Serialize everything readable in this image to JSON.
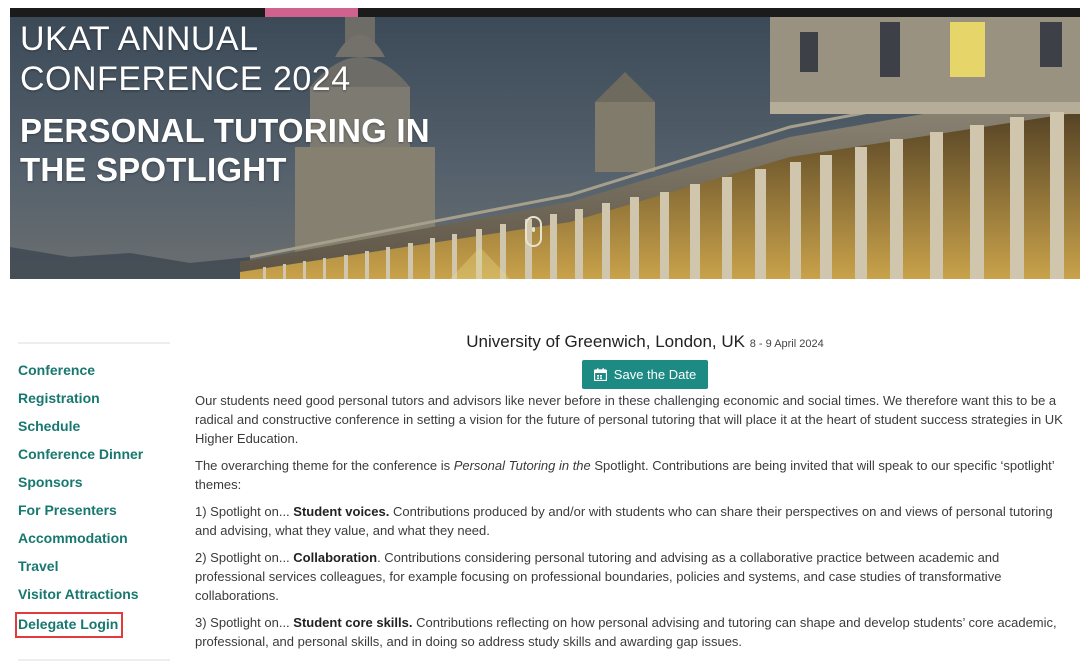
{
  "hero": {
    "title_line1": "UKAT ANNUAL",
    "title_line2": "CONFERENCE 2024",
    "subtitle_line1": "PERSONAL TUTORING IN",
    "subtitle_line2": "THE SPOTLIGHT"
  },
  "sidebar": {
    "items": [
      {
        "label": "Conference"
      },
      {
        "label": "Registration"
      },
      {
        "label": "Schedule"
      },
      {
        "label": "Conference Dinner"
      },
      {
        "label": "Sponsors"
      },
      {
        "label": "For Presenters"
      },
      {
        "label": "Accommodation"
      },
      {
        "label": "Travel"
      },
      {
        "label": "Visitor Attractions"
      },
      {
        "label": "Delegate Login"
      }
    ]
  },
  "main": {
    "location": "University of Greenwich, London, UK",
    "dates": "8 - 9 April 2024",
    "save_button": "Save the Date",
    "intro": "Our students need good personal tutors and advisors like never before in these challenging economic and social times. We therefore want this to be a radical and constructive conference in setting a vision for the future of personal tutoring that will place it at the heart of student success strategies in UK Higher Education.",
    "theme_prefix": "The overarching theme for the conference is ",
    "theme_italic": "Personal Tutoring in the",
    "theme_suffix": " Spotlight. Contributions are being invited that will speak to our specific ‘spotlight’ themes:",
    "spotlights": [
      {
        "prefix": "1) Spotlight on... ",
        "bold": "Student voices.",
        "text": " Contributions produced by and/or with students who can share their perspectives on and views of personal tutoring and advising, what they value, and what they need."
      },
      {
        "prefix": "2) Spotlight on... ",
        "bold": "Collaboration",
        "text": ". Contributions considering personal tutoring and advising as a collaborative practice between academic and professional services colleagues, for example focusing on professional boundaries, policies and systems, and case studies of transformative collaborations."
      },
      {
        "prefix": "3) Spotlight on... ",
        "bold": "Student core skills.",
        "text": " Contributions reflecting on how personal advising and tutoring can shape and develop students’ core academic, professional, and personal skills, and in doing so address study skills and awarding gap issues."
      }
    ]
  },
  "colors": {
    "accent_teal": "#1e8a84",
    "nav_link": "#17786f",
    "highlight_box": "#e23b3b",
    "top_accent": "#d0628f"
  }
}
